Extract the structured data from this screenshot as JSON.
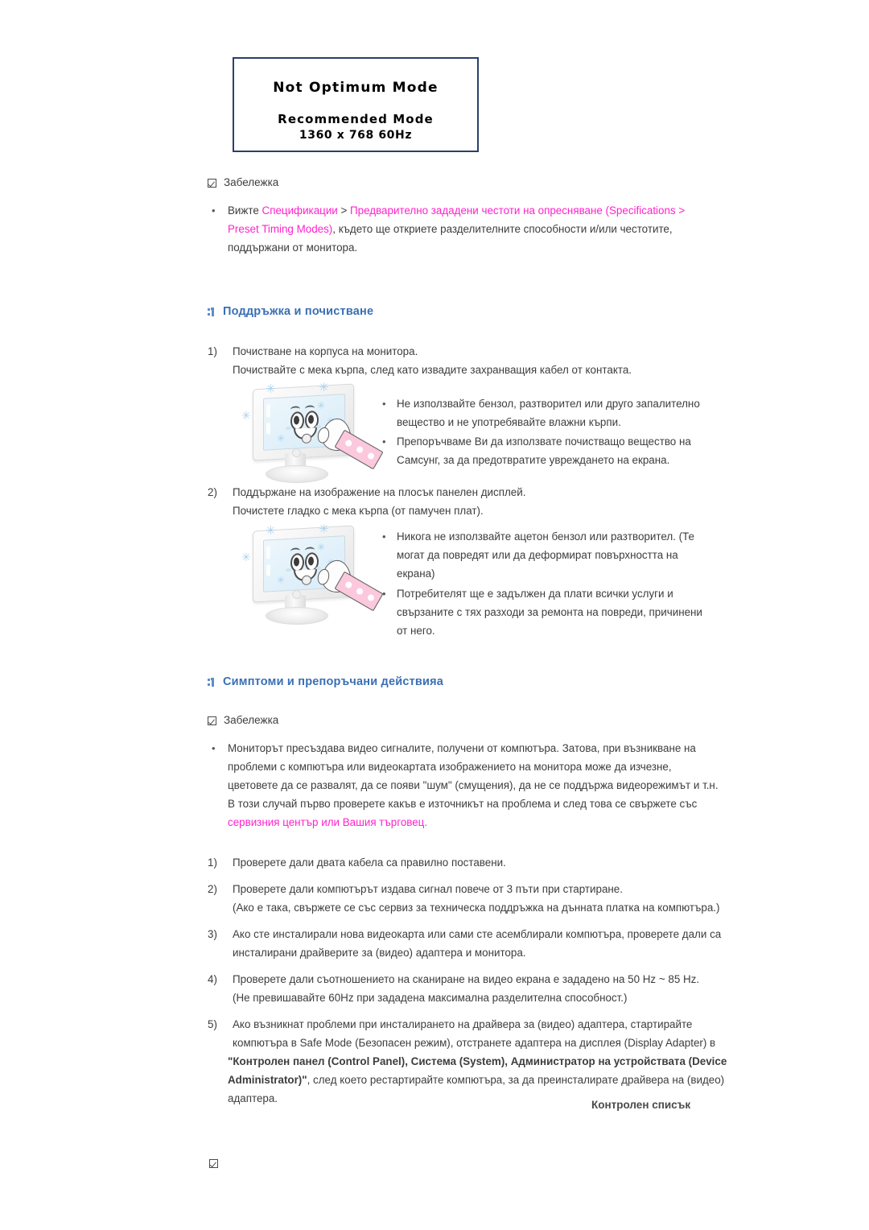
{
  "osd_box": {
    "line1": "Not Optimum Mode",
    "line2": "Recommended Mode",
    "line3": "1360 x 768  60Hz",
    "border_color": "#2a3f6b"
  },
  "colors": {
    "heading_blue": "#3a6fb5",
    "link_magenta": "#ff22cc",
    "body_text": "#3d3d3d"
  },
  "note_top": {
    "icon": "checkbox-checked-icon",
    "label": "Забележка",
    "bullet": "•",
    "text_part1": "Вижте ",
    "link1": "Спецификации",
    "text_part2": " > ",
    "link2": "Предварително зададени честоти на опресняване (Specifications > Preset",
    "link3": "Timing Modes)",
    "text_part3": ", където ще откриете разделителните способности и/или честотите, поддържани от",
    "text_part4": "монитора."
  },
  "section_maintenance": {
    "marker": "chevron-right-icon",
    "title": "Поддръжка и почистване",
    "items": [
      {
        "number": "1)",
        "line1": "Почистване на корпуса на монитора.",
        "line2": "Почиствайте с мека кърпа, след като извадите захранващия кабел от контакта.",
        "bullets": [
          "Не използвайте бензол, разтворител или друго запалително вещество и не употребявайте влажни кърпи.",
          "Препоръчваме Ви да използвате почистващо вещество на Самсунг, за да предотвратите увреждането на екрана."
        ]
      },
      {
        "number": "2)",
        "line1": "Поддържане на изображение на плосък панелен дисплей.",
        "line2": "Почистете гладко с мека кърпа (от памучен плат).",
        "bullets": [
          "Никога не използвайте ацетон бензол или разтворител. (Те могат да повредят или да деформират повърхността на екрана)",
          "Потребителят ще е задължен да плати всички услуги и свързаните с тях разходи за ремонта на повреди, причинени от него."
        ]
      }
    ]
  },
  "section_symptoms": {
    "marker": "chevron-right-icon",
    "title": "Симптоми и препоръчани действияа",
    "note": {
      "icon": "checkbox-checked-icon",
      "label": "Забележка",
      "bullet": "•",
      "line1": "Мониторът пресъздава видео сигналите, получени от компютъра. Затова, при възникване на",
      "line2": "проблеми с компютъра или видеокартата изображението на монитора може да изчезне, цветовете",
      "line3": "да се развалят, да се появи \"шум\" (смущения), да не се поддържа видеорежимът и т.н. В този",
      "line4_plain": "случай първо проверете какъв е източникът на проблема и след това се свържете със ",
      "line4_link": "сервизния",
      "line5_link": "център или Вашия търговец."
    },
    "steps": [
      {
        "number": "1)",
        "lines": [
          "Проверете дали двата кабела са правилно поставени."
        ]
      },
      {
        "number": "2)",
        "lines": [
          "Проверете дали компютърът издава сигнал повече от 3 пъти при стартиране.",
          "(Ако е така, свържете се със сервиз за техническа поддръжка на дънната платка на компютъра.)"
        ]
      },
      {
        "number": "3)",
        "lines": [
          "Ако сте инсталирали нова видеокарта или сами сте асемблирали компютъра, проверете дали са",
          "инсталирани драйверите за (видео) адаптера и монитора."
        ]
      },
      {
        "number": "4)",
        "lines": [
          "Проверете дали съотношението на сканиране на видео екрана е зададено на 50 Hz ~ 85 Hz.",
          "(Не превишавайте 60Hz при зададена максимална разделителна способност.)"
        ]
      },
      {
        "number": "5)",
        "lines": [
          "Ако възникнат проблеми при инсталирането на драйвера за (видео) адаптера, стартирайте",
          "компютъра в Safe Mode (Безопасен режим), отстранете адаптера на дисплея (Display Adapter) в",
          "адаптера."
        ],
        "bold_part1": "\"Контролен панел (Control Panel), Система (System), Администратор на устройствата (Device",
        "bold_part2": "Administrator)\"",
        "after_bold": ", след което рестартирайте компютъра, за да преинсталирате драйвера на (видео)"
      }
    ]
  },
  "footer": {
    "title": "Контролен списък",
    "icon": "checkbox-checked-icon"
  }
}
